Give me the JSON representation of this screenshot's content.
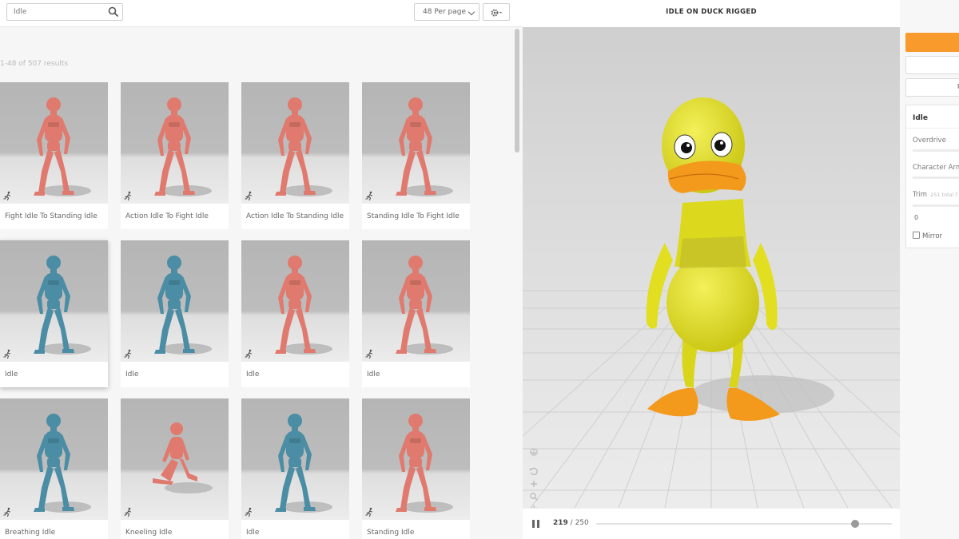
{
  "search": {
    "value": "Idle"
  },
  "toolbar": {
    "per_page": "48 Per page"
  },
  "results": {
    "text": "1-48 of 507 results"
  },
  "cards": [
    {
      "label": "Fight Idle To Standing Idle",
      "color": "#e07a6e"
    },
    {
      "label": "Action Idle To Fight Idle",
      "color": "#e07a6e"
    },
    {
      "label": "Action Idle To Standing Idle",
      "color": "#e07a6e"
    },
    {
      "label": "Standing Idle To Fight Idle",
      "color": "#e07a6e"
    },
    {
      "label": "Idle",
      "color": "#4b8da4"
    },
    {
      "label": "Idle",
      "color": "#4b8da4"
    },
    {
      "label": "Idle",
      "color": "#e07a6e"
    },
    {
      "label": "Idle",
      "color": "#e07a6e"
    },
    {
      "label": "Breathing Idle",
      "color": "#4b8da4"
    },
    {
      "label": "Kneeling Idle",
      "color": "#e07a6e"
    },
    {
      "label": "Idle",
      "color": "#4b8da4"
    },
    {
      "label": "Standing Idle",
      "color": "#e07a6e"
    }
  ],
  "viewer": {
    "title": "IDLE ON DUCK RIGGED",
    "frame_current": "219",
    "frame_total": "/ 250",
    "progress": 0.876
  },
  "settings": {
    "button3_label": "U",
    "panel_title": "Idle",
    "overdrive_label": "Overdrive",
    "arm_label": "Character Arm",
    "trim_label": "Trim",
    "trim_sub": "251 total f",
    "trim_value": "0",
    "mirror_label": "Mirror"
  },
  "colors": {
    "accent": "#f89a2c",
    "duck": "#e6e21f",
    "beak": "#f39a1c"
  }
}
